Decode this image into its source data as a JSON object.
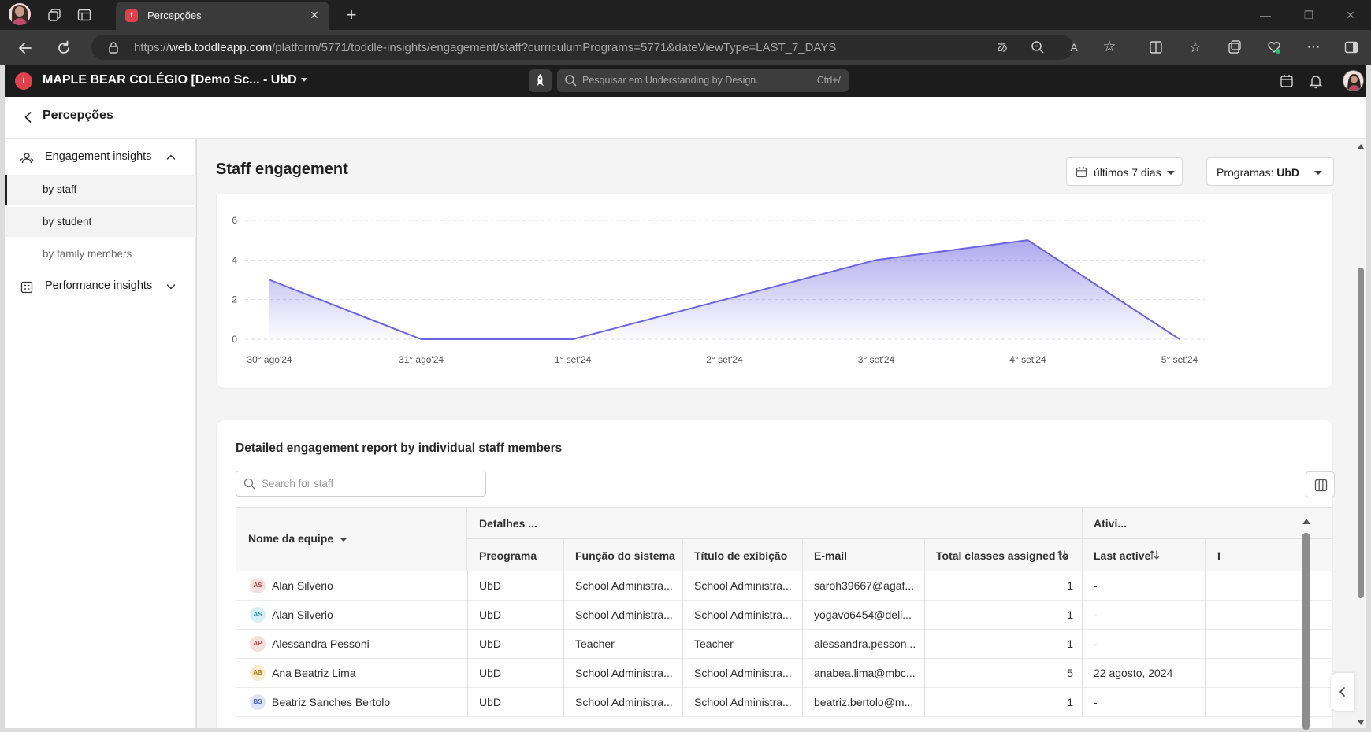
{
  "browser": {
    "tab_title": "Percepções",
    "tab_favicon_letter": "t",
    "url_prefix": "https://",
    "url_host": "web.toddleapp.com",
    "url_path": "/platform/5771/toddle-insights/engagement/staff?curriculumPrograms=5771&dateViewType=LAST_7_DAYS"
  },
  "app": {
    "logo_letter": "t",
    "school_name": "MAPLE BEAR COLÉGIO [Demo Sc... - UbD",
    "search_placeholder": "Pesquisar em Understanding by Design..",
    "search_shortcut": "Ctrl+/"
  },
  "page": {
    "title": "Percepções"
  },
  "sidebar": {
    "groups": [
      {
        "label": "Engagement insights",
        "expanded": true,
        "icon": "people-icon"
      },
      {
        "label": "Performance insights",
        "expanded": false,
        "icon": "calculator-icon"
      }
    ],
    "items": [
      {
        "label": "by staff",
        "active": true
      },
      {
        "label": "by student",
        "active": false
      },
      {
        "label": "by family members",
        "active": false
      }
    ]
  },
  "main": {
    "title": "Staff engagement",
    "date_filter": "últimos 7 dias",
    "program_filter_prefix": "Programas: ",
    "program_filter_value": "UbD"
  },
  "chart_data": {
    "type": "area",
    "x": [
      "30° ago'24",
      "31° ago'24",
      "1° set'24",
      "2° set'24",
      "3° set'24",
      "4° set'24",
      "5° set'24"
    ],
    "y_ticks": [
      "0",
      "2",
      "4",
      "6"
    ],
    "ylim": [
      0,
      6
    ],
    "series": [
      {
        "values": [
          3,
          0,
          0,
          2,
          4,
          5,
          0
        ]
      }
    ],
    "color": "#6c63e0",
    "grid": "horizontal dashed",
    "title": "",
    "xlabel": "",
    "ylabel": ""
  },
  "table": {
    "title": "Detailed engagement report by individual staff members",
    "search_placeholder": "Search for staff",
    "group_headers": {
      "details": "Detalhes ...",
      "activity": "Ativi..."
    },
    "columns": {
      "name": "Nome da equipe",
      "program": "Preograma",
      "role": "Função do sistema",
      "display_title": "Título de exibição",
      "email": "E-mail",
      "classes": "Total classes assigned to",
      "last_active": "Last active",
      "extra": "I"
    },
    "rows": [
      {
        "initials": "AS",
        "av_bg": "#f6dede",
        "av_fg": "#b04848",
        "name": "Alan Silvério",
        "program": "UbD",
        "role": "School Administra...",
        "title": "School Administra...",
        "email": "saroh39667@agaf...",
        "classes": "1",
        "last_active": "-"
      },
      {
        "initials": "AS",
        "av_bg": "#d7f0f6",
        "av_fg": "#2a8fa8",
        "name": "Alan Silverio",
        "program": "UbD",
        "role": "School Administra...",
        "title": "School Administra...",
        "email": "yogavo6454@deli...",
        "classes": "1",
        "last_active": "-"
      },
      {
        "initials": "AP",
        "av_bg": "#f6dede",
        "av_fg": "#b04848",
        "name": "Alessandra Pessoni",
        "program": "UbD",
        "role": "Teacher",
        "title": "Teacher",
        "email": "alessandra.pesson...",
        "classes": "1",
        "last_active": "-"
      },
      {
        "initials": "AB",
        "av_bg": "#fbeccc",
        "av_fg": "#a8781d",
        "name": "Ana Beatriz Lima",
        "program": "UbD",
        "role": "School Administra...",
        "title": "School Administra...",
        "email": "anabea.lima@mbc...",
        "classes": "5",
        "last_active": "22 agosto, 2024"
      },
      {
        "initials": "BS",
        "av_bg": "#dde4f8",
        "av_fg": "#4a62b4",
        "name": "Beatriz Sanches Bertolo",
        "program": "UbD",
        "role": "School Administra...",
        "title": "School Administra...",
        "email": "beatriz.bertolo@m...",
        "classes": "1",
        "last_active": "-"
      }
    ]
  }
}
